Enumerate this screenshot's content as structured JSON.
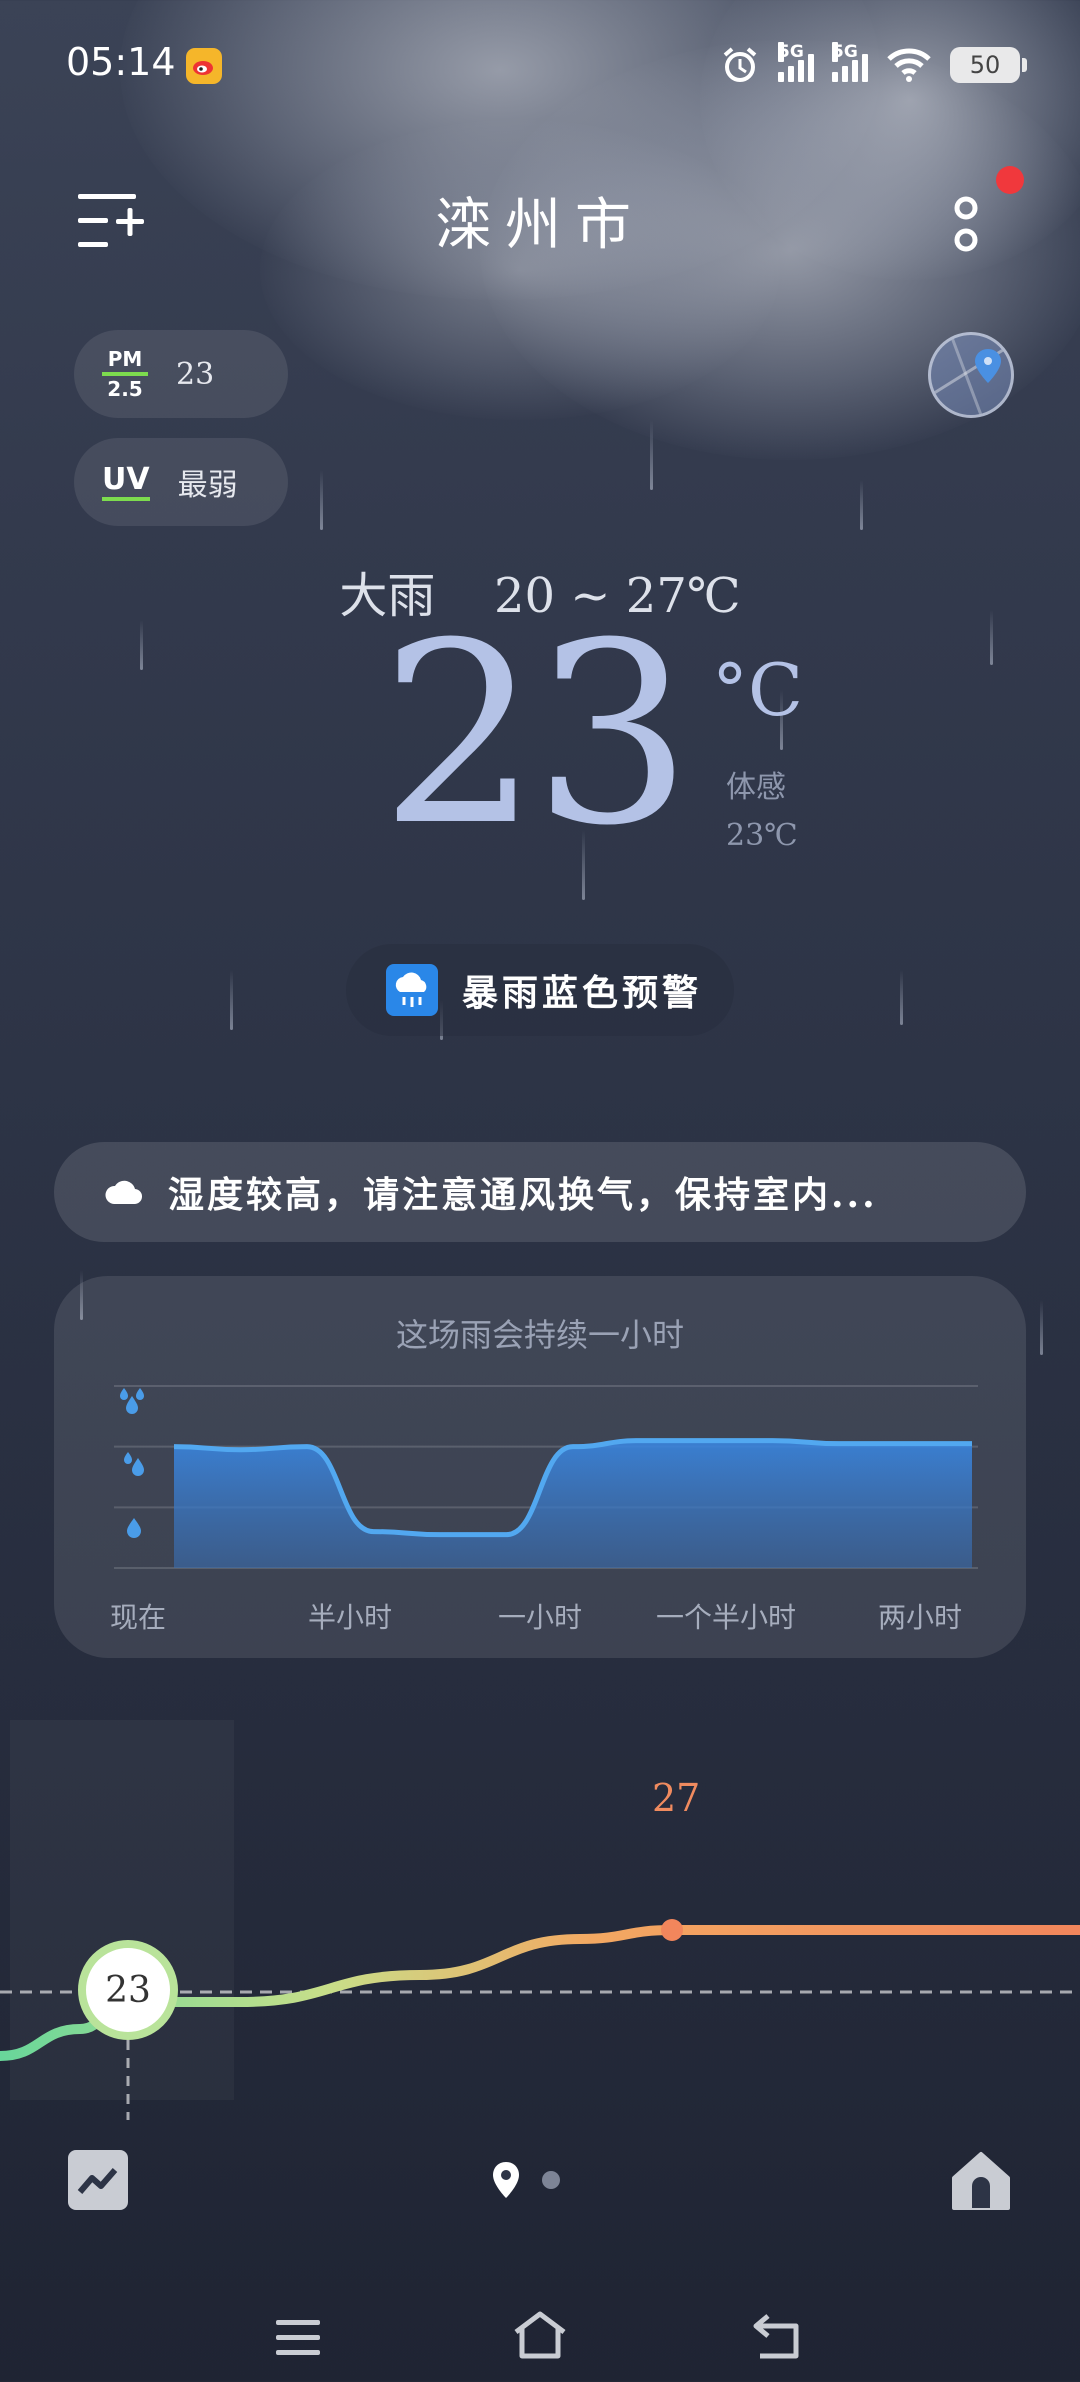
{
  "status_bar": {
    "time": "05:14",
    "net1": "5G",
    "net2": "5G",
    "battery": "50",
    "icons": [
      "weibo-icon",
      "alarm-icon",
      "signal-icon",
      "signal-icon",
      "wifi-icon",
      "battery-icon"
    ]
  },
  "header": {
    "city": "滦州市",
    "menu_icon": "add-city-icon",
    "more_icon": "more-icon"
  },
  "air": {
    "pm_label_top": "PM",
    "pm_label_bottom": "2.5",
    "pm_value": "23",
    "uv_label": "UV",
    "uv_value": "最弱"
  },
  "current": {
    "condition": "大雨",
    "range": "20 ~ 27℃",
    "temperature": "23",
    "unit": "°C",
    "feels_label": "体感",
    "feels_value": "23℃"
  },
  "alert": {
    "text": "暴雨蓝色预警",
    "icon": "rain-alert-icon"
  },
  "tip": {
    "text": "湿度较高，请注意通风换气，保持室内...",
    "icon": "cloud-icon"
  },
  "precip_card": {
    "title": "这场雨会持续一小时",
    "x_labels": [
      "现在",
      "半小时",
      "一小时",
      "一个半小时",
      "两小时"
    ],
    "y_levels": [
      "heavy",
      "moderate",
      "light"
    ],
    "intensity_levels": [
      "light",
      "moderate",
      "heavy"
    ],
    "chart_data": {
      "type": "area",
      "x": [
        "现在",
        "半小时",
        "一小时",
        "一个半小时",
        "两小时"
      ],
      "series": [
        {
          "values": [
            2.0,
            1.95,
            2.0,
            0.6,
            0.55,
            0.55,
            2.0,
            2.1,
            2.1,
            2.1,
            2.05,
            2.05,
            2.05
          ]
        }
      ],
      "ylim": [
        0,
        3
      ],
      "grid": true
    }
  },
  "temp_curve": {
    "max_label": "27",
    "now_label": "23",
    "chart_data": {
      "type": "line",
      "values": [
        20,
        21.5,
        23,
        23,
        24.5,
        26.5,
        27,
        27,
        27
      ],
      "max": 27,
      "now": 23
    }
  },
  "bottom_bar": {
    "trend_icon": "trend-chart-icon",
    "location_icon": "location-pin-icon",
    "home_icon": "home-icon"
  },
  "colors": {
    "accent_blue": "#2a87e8",
    "rain_fill": "#3a7bd5",
    "temp_hot": "#f08b5f",
    "temp_cool": "#7ddc8e",
    "alert_red": "#f0383c"
  }
}
